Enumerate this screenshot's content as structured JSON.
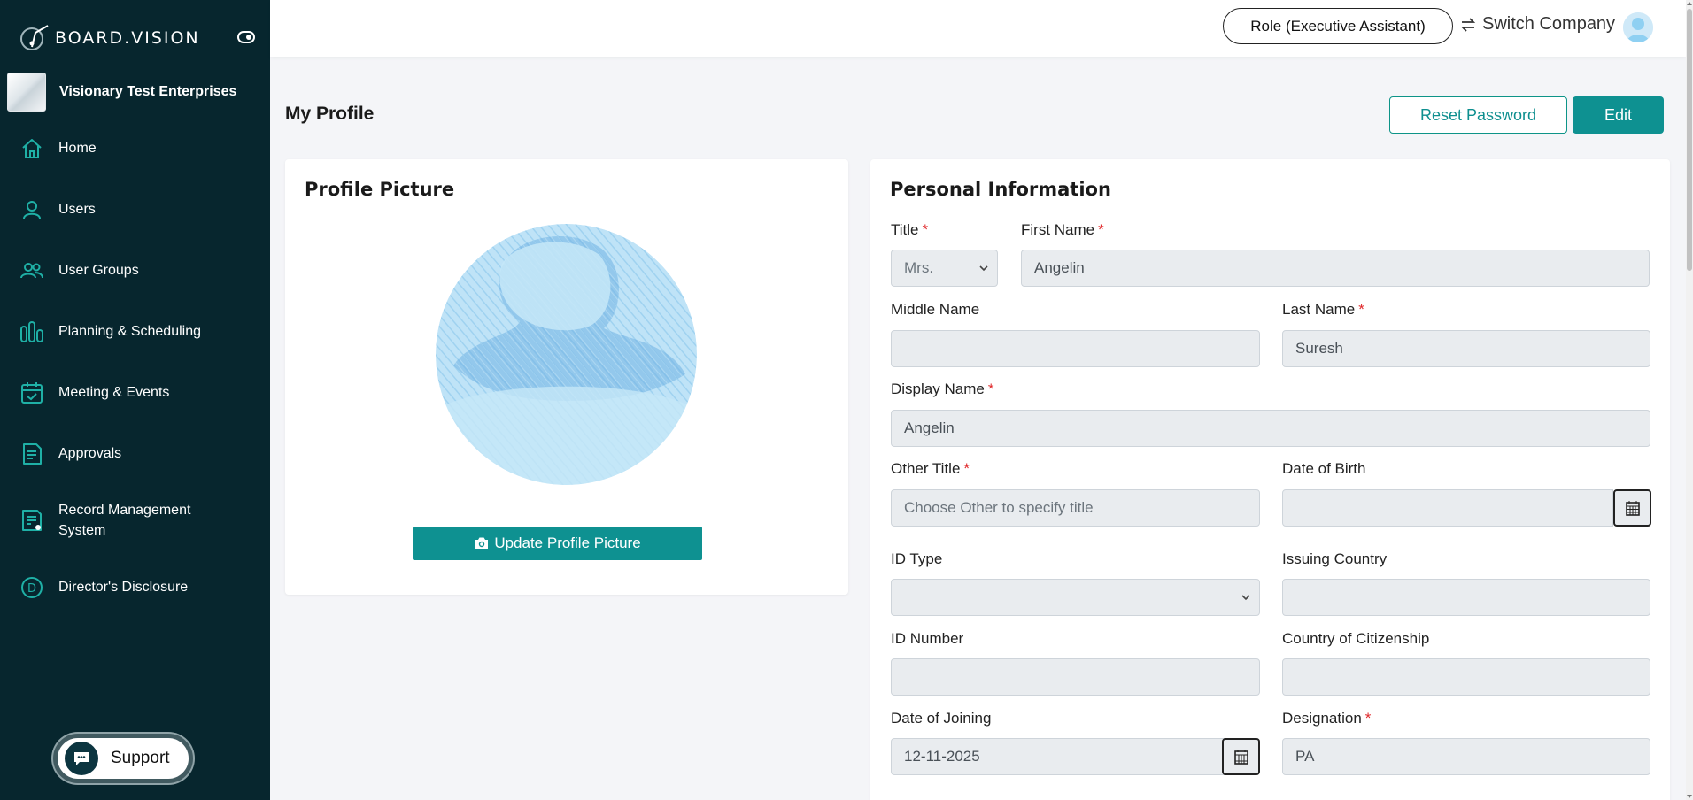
{
  "brand": {
    "name": "BOARD.VISION"
  },
  "company": {
    "name": "Visionary Test Enterprises"
  },
  "sidebar": {
    "items": [
      {
        "label": "Home",
        "icon": "home-icon"
      },
      {
        "label": "Users",
        "icon": "user-icon"
      },
      {
        "label": "User Groups",
        "icon": "users-icon"
      },
      {
        "label": "Planning & Scheduling",
        "icon": "bars-icon"
      },
      {
        "label": "Meeting & Events",
        "icon": "calendar-check-icon"
      },
      {
        "label": "Approvals",
        "icon": "document-icon"
      },
      {
        "label": "Record Management System",
        "icon": "record-icon"
      },
      {
        "label": "Director's Disclosure",
        "icon": "d-circle-icon"
      }
    ],
    "support_label": "Support"
  },
  "topbar": {
    "role_label": "Role (Executive Assistant)",
    "switch_label": "Switch Company"
  },
  "page": {
    "title": "My Profile",
    "reset_label": "Reset Password",
    "edit_label": "Edit"
  },
  "profile_card": {
    "title": "Profile Picture",
    "update_label": "Update Profile Picture"
  },
  "personal_info": {
    "title": "Personal Information",
    "title_label": "Title",
    "title_value": "Mrs.",
    "first_name_label": "First Name",
    "first_name_value": "Angelin",
    "middle_name_label": "Middle Name",
    "middle_name_value": "",
    "last_name_label": "Last Name",
    "last_name_value": "Suresh",
    "display_name_label": "Display Name",
    "display_name_value": "Angelin",
    "other_title_label": "Other Title",
    "other_title_placeholder": "Choose Other to specify title",
    "dob_label": "Date of Birth",
    "dob_value": "",
    "id_type_label": "ID Type",
    "id_type_value": "",
    "issuing_country_label": "Issuing Country",
    "issuing_country_value": "",
    "id_number_label": "ID Number",
    "id_number_value": "",
    "citizenship_label": "Country of Citizenship",
    "citizenship_value": "",
    "joining_label": "Date of Joining",
    "joining_value": "12-11-2025",
    "designation_label": "Designation",
    "designation_value": "PA"
  },
  "colors": {
    "sidebar_bg": "#07262e",
    "accent": "#0e9191",
    "icon_teal": "#1fb0a6",
    "required": "#e0282a"
  }
}
